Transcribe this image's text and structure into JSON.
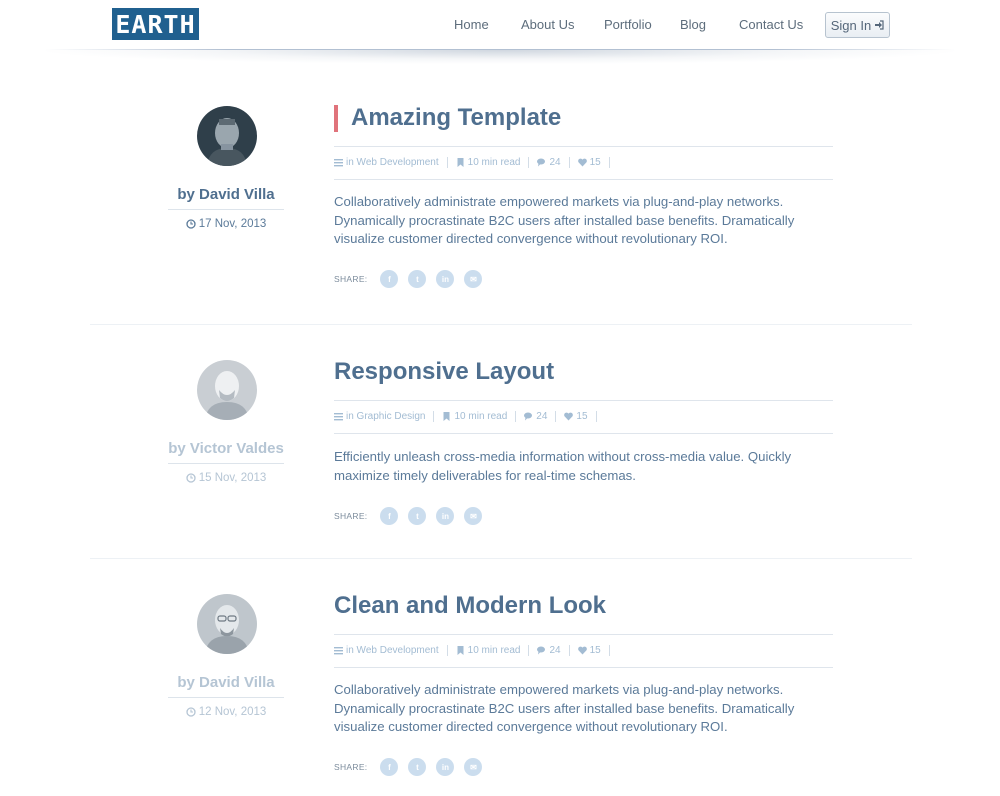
{
  "header": {
    "logo": "EARTH",
    "nav": [
      "Home",
      "About Us",
      "Portfolio",
      "Blog",
      "Contact Us"
    ],
    "signin_label": "Sign In"
  },
  "icons": {
    "signin": "sign-in-icon",
    "date": "clock-icon",
    "category": "list-icon",
    "read_time": "bookmark-icon",
    "comments": "comments-icon",
    "likes": "heart-icon",
    "share": [
      "facebook-icon",
      "twitter-icon",
      "linkedin-icon",
      "envelope-icon"
    ]
  },
  "colors": {
    "logo_bg": "#20608f",
    "title": "#4f6f8f",
    "accent": "#e0737b",
    "text": "#5b7a99",
    "muted": "#b5c5d4",
    "share_icon_bg": "#cbddee"
  },
  "share_label": "SHARE:",
  "share_glyphs": [
    "f",
    "t",
    "in",
    "✉"
  ],
  "posts": [
    {
      "author": "by David Villa",
      "date": "17 Nov, 2013",
      "title": "Amazing Template",
      "category": "in Web Development",
      "read_time": "10 min read",
      "comments": "24",
      "likes": "15",
      "excerpt": "Collaboratively administrate empowered markets via plug-and-play networks. Dynamically procrastinate B2C users after installed base benefits. Dramatically visualize customer directed convergence without revolutionary ROI."
    },
    {
      "author": "by Victor Valdes",
      "date": "15 Nov, 2013",
      "title": "Responsive Layout",
      "category": "in Graphic Design",
      "read_time": "10 min read",
      "comments": "24",
      "likes": "15",
      "excerpt": "Efficiently unleash cross-media information without cross-media value. Quickly maximize timely deliverables for real-time schemas."
    },
    {
      "author": "by David Villa",
      "date": "12 Nov, 2013",
      "title": "Clean and Modern Look",
      "category": "in Web Development",
      "read_time": "10 min read",
      "comments": "24",
      "likes": "15",
      "excerpt": "Collaboratively administrate empowered markets via plug-and-play networks. Dynamically procrastinate B2C users after installed base benefits. Dramatically visualize customer directed convergence without revolutionary ROI."
    }
  ]
}
